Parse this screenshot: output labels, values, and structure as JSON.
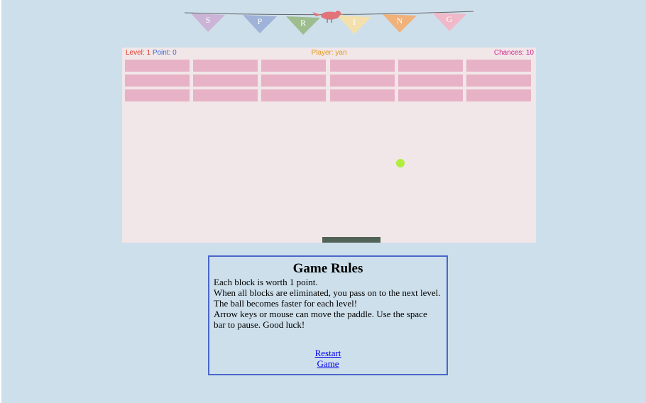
{
  "banner": {
    "letters": [
      "S",
      "P",
      "R",
      "I",
      "N",
      "G"
    ],
    "flag_colors": [
      "#cbb4d6",
      "#9fb2d8",
      "#9dbd8f",
      "#f3e0ad",
      "#f0b17a",
      "#efb9c9"
    ],
    "bird_color": "#e27379"
  },
  "hud": {
    "level_label": "Level:",
    "level_value": "1",
    "point_label": "Point:",
    "point_value": "0",
    "player": "Player: yan",
    "chances": "Chances: 10"
  },
  "game": {
    "brick_rows": 3,
    "brick_cols": 6,
    "brick_color": "#e8b2c6",
    "ball_color": "#b0ee3a",
    "paddle_color": "#516356",
    "board_color": "#f1e6e8"
  },
  "rules": {
    "title": "Game Rules",
    "line1": "Each block is worth 1 point.",
    "line2": "When all blocks are eliminated, you pass on to the next level.",
    "line3": "The ball becomes faster for each level!",
    "line4": "Arrow keys or mouse can move the paddle. Use the space bar to pause. Good luck!",
    "restart": "Restart",
    "game": "Game"
  }
}
